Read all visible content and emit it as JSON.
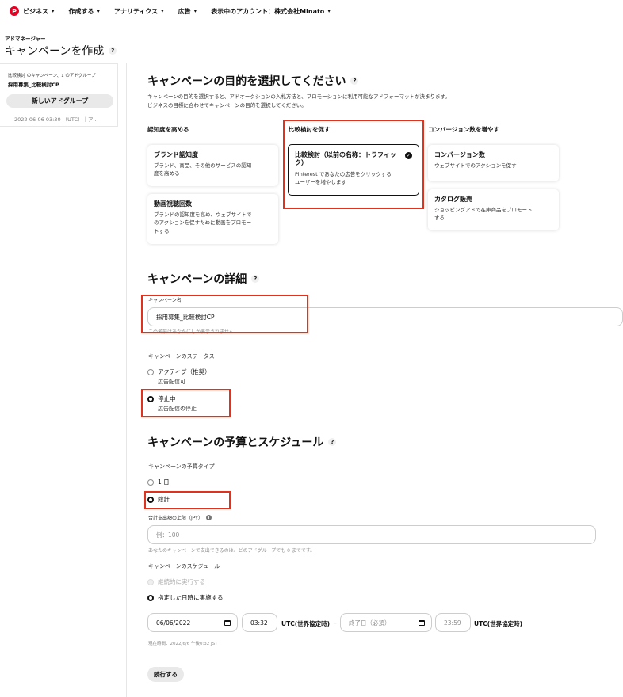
{
  "nav": {
    "logo_glyph": "P",
    "items": [
      {
        "label": "ビジネス"
      },
      {
        "label": "作成する"
      },
      {
        "label": "アナリティクス"
      },
      {
        "label": "広告"
      },
      {
        "label": "表示中のアカウント：株式会社Minato"
      }
    ]
  },
  "header": {
    "supertitle": "アドマネージャー",
    "title": "キャンペーンを作成"
  },
  "sidebar": {
    "caption": "比較検討 のキャンペーン、1 のアドグループ",
    "campaign_name": "採用募集_比較検討CP",
    "new_adgroup_label": "新しいアドグループ",
    "date": "2022-06-06 03:30 （UTC）｜ア..."
  },
  "objective": {
    "title": "キャンペーンの目的を選択してください",
    "desc_line1": "キャンペーンの目的を選択すると、アドオークションの入札方法と、プロモーションに利用可能なアドフォーマットが決まります。",
    "desc_line2": "ビジネスの目標に合わせてキャンペーンの目的を選択してください。",
    "columns": [
      {
        "heading": "認知度を高める",
        "cards": [
          {
            "title": "ブランド認知度",
            "desc1": "ブランド、商品、その他のサービスの認知",
            "desc2": "度を高める"
          },
          {
            "title": "動画視聴回数",
            "desc1": "ブランドの認知度を高め、ウェブサイトで",
            "desc2": "のアクションを促すために動画をプロモー",
            "desc3": "トする"
          }
        ]
      },
      {
        "heading": "比較検討を促す",
        "cards": [
          {
            "title1": "比較検討（以前の名称：トラフィッ",
            "title2": "ク）",
            "desc1": "Pinterest であなたの広告をクリックする",
            "desc2": "ユーザーを増やします",
            "selected": true
          }
        ]
      },
      {
        "heading": "コンバージョン数を増やす",
        "cards": [
          {
            "title": "コンバージョン数",
            "desc1": "ウェブサイトでのアクションを促す"
          },
          {
            "title": "カタログ販売",
            "desc1": "ショッピングアドで在庫商品をプロモート",
            "desc2": "する"
          }
        ]
      }
    ]
  },
  "details": {
    "title": "キャンペーンの詳細",
    "name_label": "キャンペーン名",
    "name_value": "採用募集_比較検討CP",
    "name_helper": "この名前はあなたにしか表示されません",
    "status_label": "キャンペーンのステータス",
    "status_options": [
      {
        "label": "アクティブ（推奨）",
        "sub": "広告配信可",
        "selected": false
      },
      {
        "label": "停止中",
        "sub": "広告配信の停止",
        "selected": true
      }
    ]
  },
  "budget": {
    "title": "キャンペーンの予算とスケジュール",
    "type_label": "キャンペーンの予算タイプ",
    "type_options": [
      {
        "label": "1 日",
        "selected": false
      },
      {
        "label": "総計",
        "selected": true
      }
    ],
    "limit_label": "合計支出額の上限（JPY）",
    "limit_placeholder": "例：100",
    "limit_helper": "あなたのキャンペーンで支出できるのは、どのアドグループでも 0 までです。",
    "schedule_label": "キャンペーンのスケジュール",
    "schedule_options": [
      {
        "label": "継続的に実行する",
        "disabled": true
      },
      {
        "label": "指定した日時に実施する",
        "selected": true
      }
    ],
    "start_date": "06/06/2022",
    "start_time": "03:32",
    "utc_label": "UTC(世界協定時)",
    "dash": "–",
    "end_date_placeholder": "終了日（必須）",
    "end_time_placeholder": "23:59",
    "current_time": "現在時間：2022/6/6 午後0:32 JST",
    "continue_label": "続行する"
  },
  "colors": {
    "brand": "#e60023",
    "highlight": "#e0321c"
  },
  "icons": {
    "help": "?",
    "check": "✓",
    "chevron": "⌄",
    "info": "i"
  }
}
